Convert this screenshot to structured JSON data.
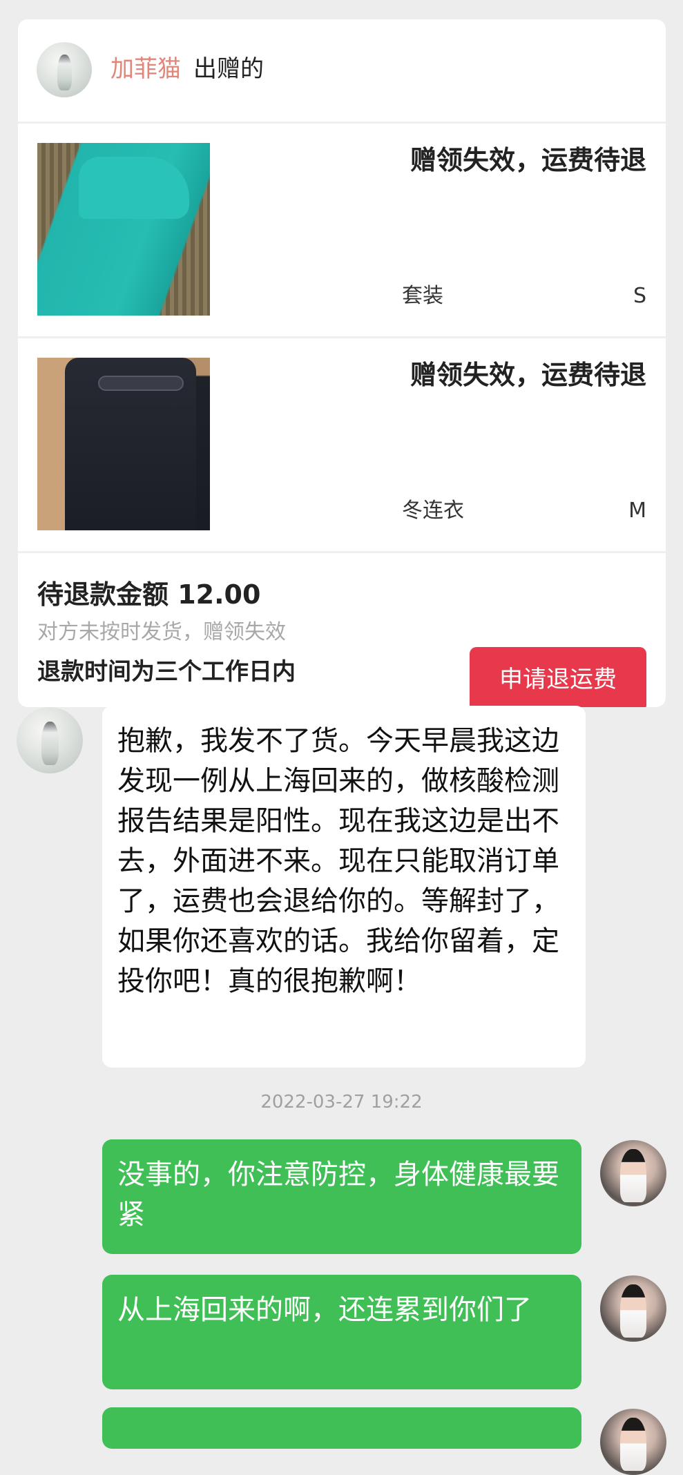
{
  "order": {
    "seller_name": "加菲猫",
    "header_suffix": "出赠的",
    "items": [
      {
        "status": "赠领失效，运费待退",
        "name": "套装",
        "size": "S"
      },
      {
        "status": "赠领失效，运费待退",
        "name": "冬连衣",
        "size": "M"
      }
    ],
    "refund_amount_text": "待退款金额 12.00",
    "refund_reason": "对方未按时发货，赠领失效",
    "refund_time": "退款时间为三个工作日内",
    "refund_button_label": "申请退运费"
  },
  "chat": {
    "messages": [
      {
        "direction": "incoming",
        "text": "抱歉，我发不了货。今天早晨我这边发现一例从上海回来的，做核酸检测报告结果是阳性。现在我这边是出不去，外面进不来。现在只能取消订单了，运费也会退给你的。等解封了，如果你还喜欢的话。我给你留着，定投你吧！真的很抱歉啊！"
      },
      {
        "direction": "outgoing",
        "text": "没事的，你注意防控，身体健康最要紧"
      },
      {
        "direction": "outgoing",
        "text": "从上海回来的啊，还连累到你们了"
      }
    ],
    "timestamp": "2022-03-27 19:22"
  },
  "colors": {
    "accent_red": "#e8394c",
    "seller_name": "#e1867b",
    "outgoing_bubble": "#3fbf55",
    "background": "#ededed"
  }
}
